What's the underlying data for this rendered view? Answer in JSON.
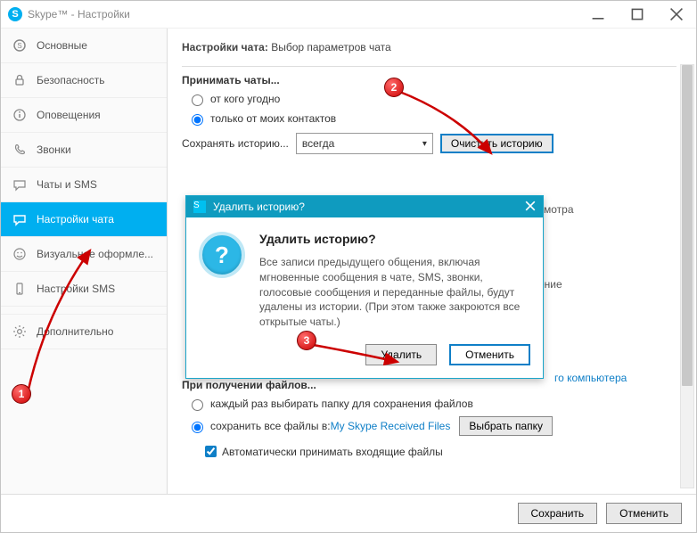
{
  "window": {
    "title": "Skype™ - Настройки"
  },
  "sidebar": {
    "items": [
      {
        "label": "Основные"
      },
      {
        "label": "Безопасность"
      },
      {
        "label": "Оповещения"
      },
      {
        "label": "Звонки"
      },
      {
        "label": "Чаты и SMS"
      },
      {
        "label": "Настройки чата"
      },
      {
        "label": "Визуальное оформле..."
      },
      {
        "label": "Настройки SMS"
      },
      {
        "label": "Дополнительно"
      }
    ]
  },
  "header": {
    "bold": "Настройки чата:",
    "rest": "Выбор параметров чата"
  },
  "accept": {
    "label": "Принимать чаты...",
    "opt_anyone": "от кого угодно",
    "opt_contacts": "только от моих контактов"
  },
  "history": {
    "label": "Сохранять историю...",
    "select_value": "всегда",
    "clear_button": "Очистить историю"
  },
  "display_cut": {
    "tail1": "смотра",
    "tail2": "ение",
    "tail3": "го компьютера"
  },
  "files": {
    "label": "При получении файлов...",
    "opt_ask": "каждый раз выбирать папку для сохранения файлов",
    "opt_save_prefix": "сохранить все файлы в: ",
    "opt_save_link": "My Skype Received Files",
    "choose_button": "Выбрать папку",
    "auto_accept": "Автоматически принимать входящие файлы"
  },
  "footer": {
    "save": "Сохранить",
    "cancel": "Отменить"
  },
  "modal": {
    "titlebar": "Удалить историю?",
    "heading": "Удалить историю?",
    "body": "Все записи предыдущего общения, включая мгновенные сообщения в чате, SMS, звонки, голосовые сообщения и переданные файлы, будут удалены из истории. (При этом также закроются все открытые чаты.)",
    "delete": "Удалить",
    "cancel": "Отменить"
  },
  "markers": {
    "m1": "1",
    "m2": "2",
    "m3": "3"
  }
}
